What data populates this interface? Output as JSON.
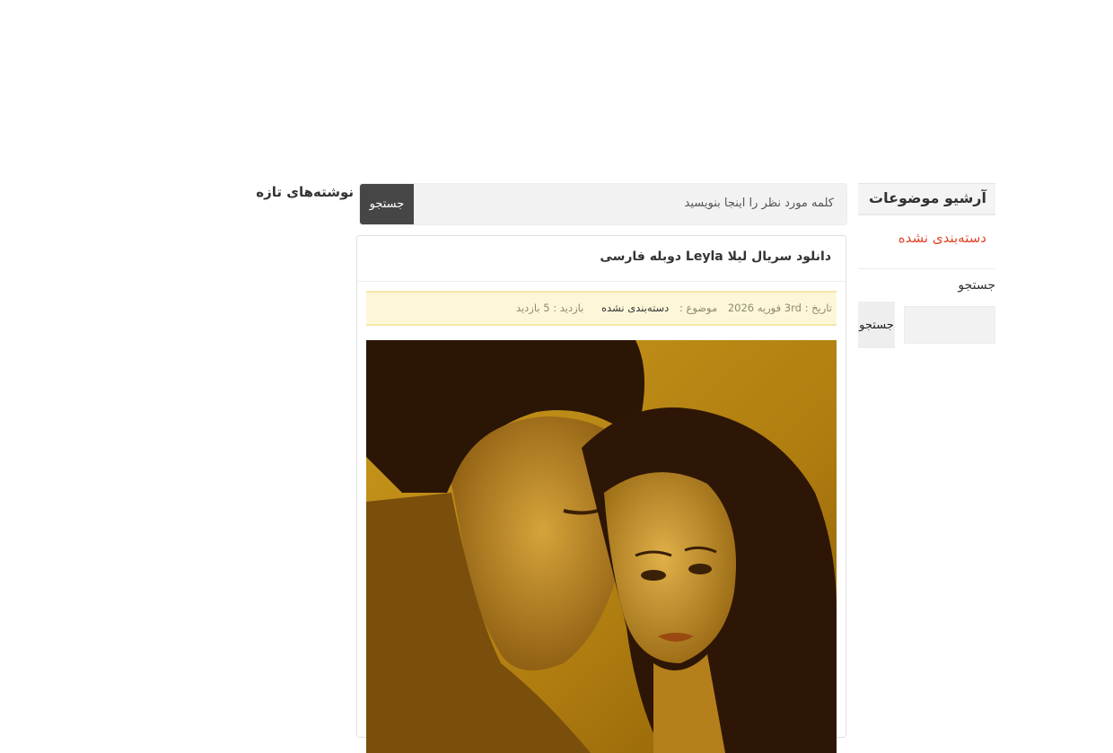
{
  "sidebar": {
    "archive_title": "آرشیو موضوعات",
    "categories": [
      "دسته‌بندی نشده"
    ],
    "search_label": "جستجو",
    "search_button": "جستجو"
  },
  "search": {
    "placeholder": "کلمه مورد نظر را اینجا بنویسید",
    "button": "جستجو"
  },
  "recent_posts_title": "نوشته‌های تازه",
  "post": {
    "title": "دانلود سریال لیلا Leyla دوبله فارسی",
    "date": "تاریخ : 3rd فوریه 2026",
    "category_label": "موضوع :",
    "category_value": "دسته‌بندی نشده",
    "views": "بازدید : 5 بازدید",
    "image": "poster of a man and a woman in golden tone"
  },
  "colors": {
    "accent_link": "#e0452b",
    "search_button_bg": "#464646",
    "meta_bg": "#fdf7d8"
  }
}
